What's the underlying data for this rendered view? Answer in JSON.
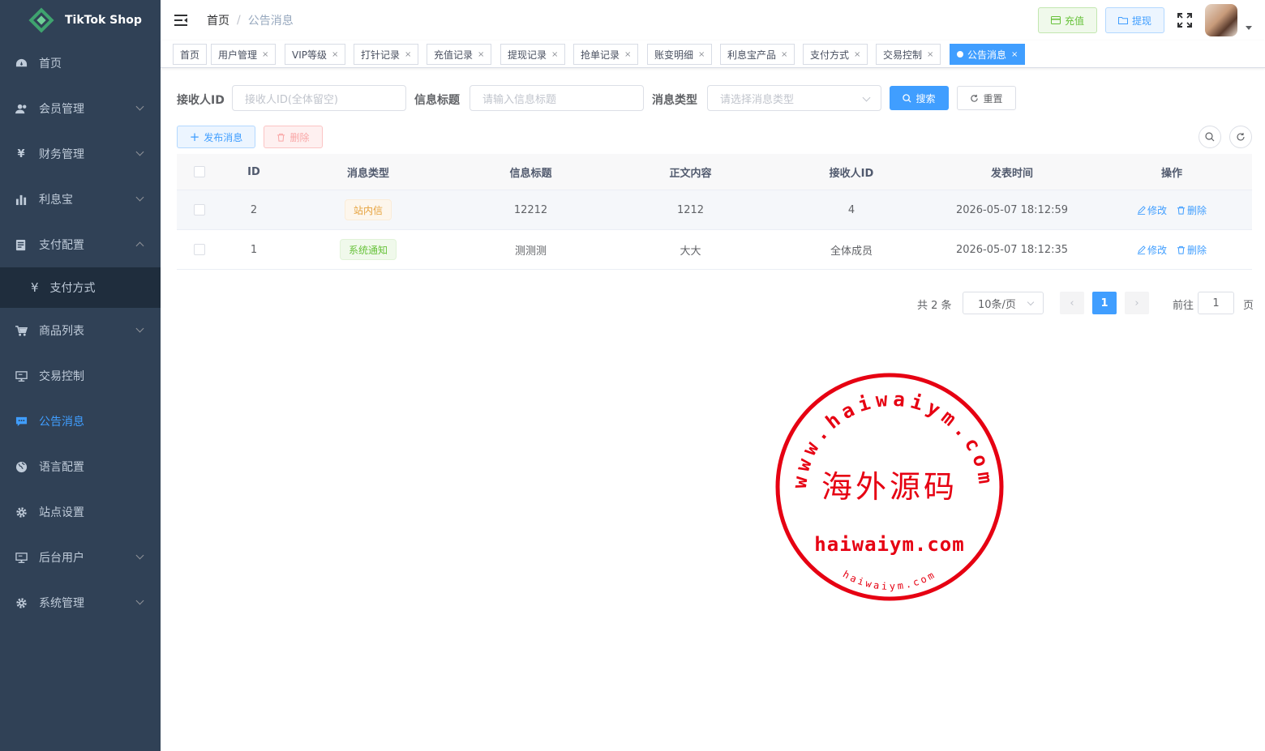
{
  "app": {
    "name": "TikTok Shop"
  },
  "sidebar": {
    "items": [
      {
        "label": "首页",
        "icon": "dashboard-icon"
      },
      {
        "label": "会员管理",
        "icon": "users-icon",
        "expandable": true
      },
      {
        "label": "财务管理",
        "icon": "yen-icon",
        "expandable": true
      },
      {
        "label": "利息宝",
        "icon": "bar-chart-icon",
        "expandable": true
      },
      {
        "label": "支付配置",
        "icon": "list-icon",
        "expandable": true,
        "expanded": true
      },
      {
        "label": "支付方式",
        "icon": "yen-icon",
        "sub": true
      },
      {
        "label": "商品列表",
        "icon": "cart-icon",
        "expandable": true
      },
      {
        "label": "交易控制",
        "icon": "monitor-icon"
      },
      {
        "label": "公告消息",
        "icon": "message-icon",
        "active": true
      },
      {
        "label": "语言配置",
        "icon": "globe-icon"
      },
      {
        "label": "站点设置",
        "icon": "gear-icon"
      },
      {
        "label": "后台用户",
        "icon": "monitor-icon",
        "expandable": true
      },
      {
        "label": "系统管理",
        "icon": "gear-icon",
        "expandable": true
      }
    ]
  },
  "header": {
    "breadcrumb": {
      "home": "首页",
      "current": "公告消息"
    },
    "recharge_label": "充值",
    "withdraw_label": "提现"
  },
  "tags": [
    {
      "label": "首页",
      "closable": false
    },
    {
      "label": "用户管理",
      "closable": true
    },
    {
      "label": "VIP等级",
      "closable": true
    },
    {
      "label": "打针记录",
      "closable": true
    },
    {
      "label": "充值记录",
      "closable": true
    },
    {
      "label": "提现记录",
      "closable": true
    },
    {
      "label": "抢单记录",
      "closable": true
    },
    {
      "label": "账变明细",
      "closable": true
    },
    {
      "label": "利息宝产品",
      "closable": true
    },
    {
      "label": "支付方式",
      "closable": true
    },
    {
      "label": "交易控制",
      "closable": true
    },
    {
      "label": "公告消息",
      "closable": true,
      "active": true
    }
  ],
  "filters": {
    "receiver_label": "接收人ID",
    "receiver_placeholder": "接收人ID(全体留空)",
    "title_label": "信息标题",
    "title_placeholder": "请输入信息标题",
    "type_label": "消息类型",
    "type_placeholder": "请选择消息类型",
    "search_label": "搜索",
    "reset_label": "重置"
  },
  "toolbar": {
    "publish_label": "发布消息",
    "delete_label": "删除"
  },
  "table": {
    "columns": [
      "ID",
      "消息类型",
      "信息标题",
      "正文内容",
      "接收人ID",
      "发表时间",
      "操作"
    ],
    "rows": [
      {
        "id": "2",
        "type": "站内信",
        "type_style": "warn",
        "title": "12212",
        "body": "1212",
        "receiver": "4",
        "time": "2026-05-07 18:12:59",
        "edit": "修改",
        "delete": "删除"
      },
      {
        "id": "1",
        "type": "系统通知",
        "type_style": "ok",
        "title": "测测测",
        "body": "大大",
        "receiver": "全体成员",
        "time": "2026-05-07 18:12:35",
        "edit": "修改",
        "delete": "删除"
      }
    ]
  },
  "pagination": {
    "total": "共 2 条",
    "page_size": "10条/页",
    "current_page": "1",
    "goto_label": "前往",
    "goto_value": "1",
    "page_suffix": "页"
  },
  "watermark": {
    "top_arc": "www.haiwaiym.com",
    "center": "海外源码",
    "domain": "haiwaiym.com",
    "bottom_arc": "haiwaiym.com"
  },
  "colors": {
    "sidebar_bg": "#304156",
    "primary": "#409eff",
    "success": "#67c23a",
    "warning": "#e6a23c",
    "danger": "#f56c6c",
    "stamp": "#e60012"
  }
}
